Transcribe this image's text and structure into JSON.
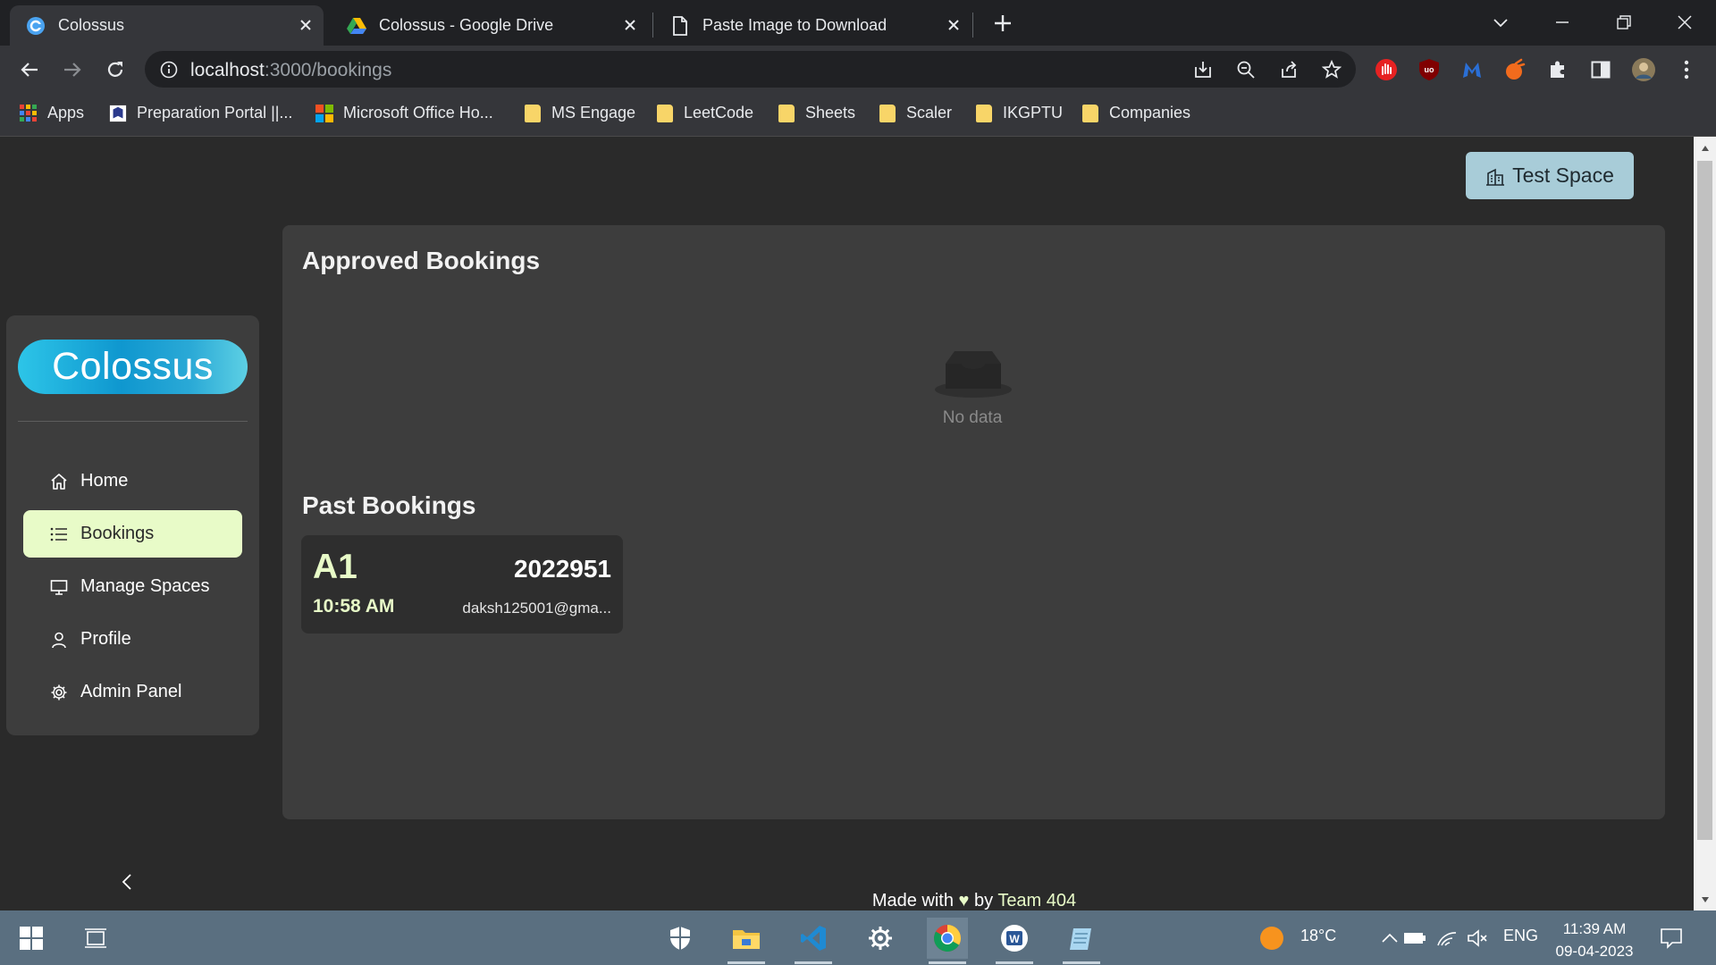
{
  "browser": {
    "tabs": [
      {
        "title": "Colossus",
        "icon": "colossus-favicon",
        "active": true
      },
      {
        "title": "Colossus - Google Drive",
        "icon": "google-drive-icon",
        "active": false
      },
      {
        "title": "Paste Image to Download",
        "icon": "document-icon",
        "active": false
      }
    ],
    "url_host": "localhost",
    "url_path": ":3000/bookings",
    "bookmarks": [
      {
        "label": "Apps",
        "icon": "apps-grid-icon"
      },
      {
        "label": "Preparation Portal ||...",
        "icon": "portal-icon"
      },
      {
        "label": "Microsoft Office Ho...",
        "icon": "microsoft-icon"
      },
      {
        "label": "MS Engage",
        "icon": "folder-icon"
      },
      {
        "label": "LeetCode",
        "icon": "folder-icon"
      },
      {
        "label": "Sheets",
        "icon": "folder-icon"
      },
      {
        "label": "Scaler",
        "icon": "folder-icon"
      },
      {
        "label": "IKGPTU",
        "icon": "folder-icon"
      },
      {
        "label": "Companies",
        "icon": "folder-icon"
      }
    ]
  },
  "app": {
    "logo": "Colossus",
    "test_space_label": "Test Space",
    "nav": [
      {
        "label": "Home",
        "icon": "home-icon",
        "active": false
      },
      {
        "label": "Bookings",
        "icon": "list-icon",
        "active": true
      },
      {
        "label": "Manage Spaces",
        "icon": "monitor-icon",
        "active": false
      },
      {
        "label": "Profile",
        "icon": "user-icon",
        "active": false
      },
      {
        "label": "Admin Panel",
        "icon": "gear-icon",
        "active": false
      }
    ],
    "approved_title": "Approved Bookings",
    "empty_text": "No data",
    "past_title": "Past Bookings",
    "past_bookings": [
      {
        "seat": "A1",
        "time": "10:58 AM",
        "id": "2022951",
        "email": "daksh125001@gma..."
      }
    ],
    "footer": {
      "prefix": "Made with",
      "heart": "♥",
      "by": "by",
      "team": "Team 404"
    }
  },
  "taskbar": {
    "weather": "18°C",
    "language": "ENG",
    "time": "11:39 AM",
    "date": "09-04-2023"
  },
  "colors": {
    "accent_light": "#e8fbc8",
    "logo_blue": "#0f97cf",
    "test_space_bg": "#a8ccd8",
    "panel_bg": "#3d3d3d",
    "page_bg": "#2a2a2a"
  }
}
